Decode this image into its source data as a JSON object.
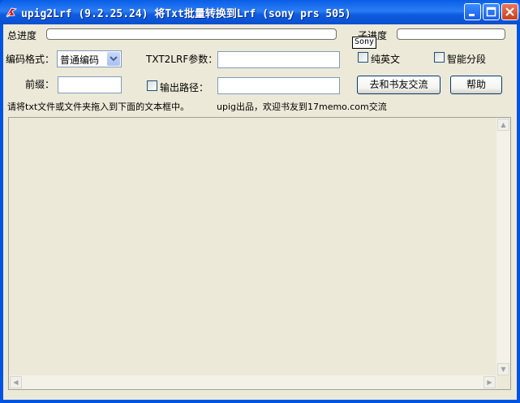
{
  "window": {
    "title": "upig2Lrf (9.2.25.24) 将Txt批量转换到Lrf (sony prs 505)"
  },
  "progress": {
    "total_label": "总进度",
    "sub_label": "子进度",
    "tooltip": "Sony"
  },
  "encoding": {
    "label": "编码格式：",
    "selected": "普通编码"
  },
  "params": {
    "label": "TXT2LRF参数：",
    "value": ""
  },
  "options": {
    "pure_english": "纯英文",
    "smart_paragraph": "智能分段",
    "output_path": "输出路径："
  },
  "prefix": {
    "label": "前缀：",
    "value": ""
  },
  "buttons": {
    "forum": "去和书友交流",
    "help": "帮助"
  },
  "info": {
    "drop_hint": "请将txt文件或文件夹拖入到下面的文本框中。",
    "credit": "upig出品，欢迎书友到17memo.com交流"
  },
  "icons": {
    "app": "upig-app-icon",
    "minimize": "minimize-icon",
    "maximize": "maximize-icon",
    "close": "close-icon"
  }
}
